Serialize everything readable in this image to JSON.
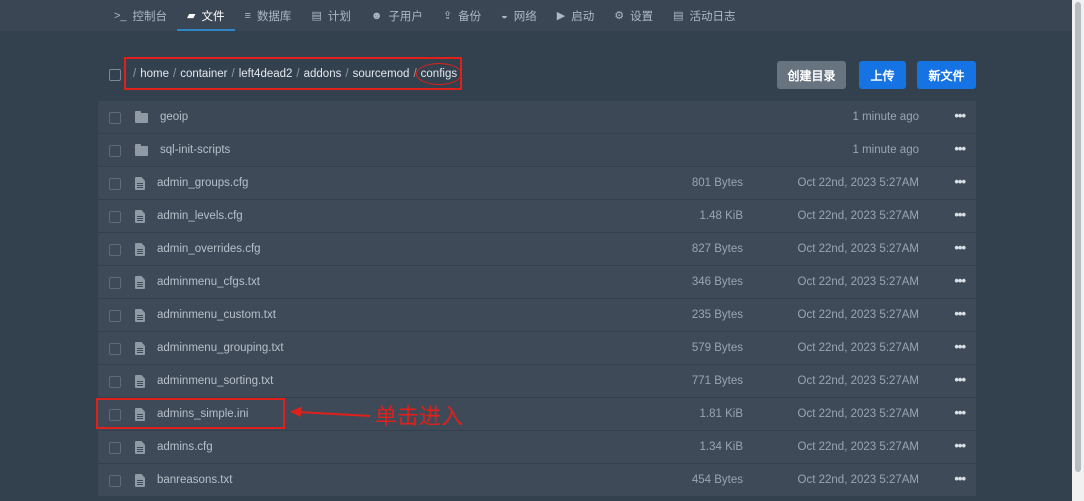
{
  "nav": [
    {
      "label": "控制台",
      "icon": "terminal-icon",
      "glyph": ">_",
      "active": false
    },
    {
      "label": "文件",
      "icon": "folder-icon",
      "glyph": "▰",
      "active": true
    },
    {
      "label": "数据库",
      "icon": "database-icon",
      "glyph": "≡",
      "active": false
    },
    {
      "label": "计划",
      "icon": "calendar-icon",
      "glyph": "▤",
      "active": false
    },
    {
      "label": "子用户",
      "icon": "users-icon",
      "glyph": "☻",
      "active": false
    },
    {
      "label": "备份",
      "icon": "upload-icon",
      "glyph": "⇪",
      "active": false
    },
    {
      "label": "网络",
      "icon": "network-icon",
      "glyph": "◒",
      "active": false
    },
    {
      "label": "启动",
      "icon": "play-icon",
      "glyph": "▶",
      "active": false
    },
    {
      "label": "设置",
      "icon": "gear-icon",
      "glyph": "⚙",
      "active": false
    },
    {
      "label": "活动日志",
      "icon": "log-icon",
      "glyph": "▤",
      "active": false
    }
  ],
  "breadcrumb": {
    "separator": "/",
    "parts": [
      "home",
      "container",
      "left4dead2",
      "addons",
      "sourcemod"
    ],
    "current": "configs"
  },
  "buttons": {
    "mkdir": "创建目录",
    "upload": "上传",
    "new_file": "新文件"
  },
  "more_glyph": "•••",
  "files": [
    {
      "type": "dir",
      "name": "geoip",
      "size": "",
      "date": "1 minute ago"
    },
    {
      "type": "dir",
      "name": "sql-init-scripts",
      "size": "",
      "date": "1 minute ago"
    },
    {
      "type": "file",
      "name": "admin_groups.cfg",
      "size": "801 Bytes",
      "date": "Oct 22nd, 2023 5:27AM"
    },
    {
      "type": "file",
      "name": "admin_levels.cfg",
      "size": "1.48 KiB",
      "date": "Oct 22nd, 2023 5:27AM"
    },
    {
      "type": "file",
      "name": "admin_overrides.cfg",
      "size": "827 Bytes",
      "date": "Oct 22nd, 2023 5:27AM"
    },
    {
      "type": "file",
      "name": "adminmenu_cfgs.txt",
      "size": "346 Bytes",
      "date": "Oct 22nd, 2023 5:27AM"
    },
    {
      "type": "file",
      "name": "adminmenu_custom.txt",
      "size": "235 Bytes",
      "date": "Oct 22nd, 2023 5:27AM"
    },
    {
      "type": "file",
      "name": "adminmenu_grouping.txt",
      "size": "579 Bytes",
      "date": "Oct 22nd, 2023 5:27AM"
    },
    {
      "type": "file",
      "name": "adminmenu_sorting.txt",
      "size": "771 Bytes",
      "date": "Oct 22nd, 2023 5:27AM"
    },
    {
      "type": "file",
      "name": "admins_simple.ini",
      "size": "1.81 KiB",
      "date": "Oct 22nd, 2023 5:27AM"
    },
    {
      "type": "file",
      "name": "admins.cfg",
      "size": "1.34 KiB",
      "date": "Oct 22nd, 2023 5:27AM"
    },
    {
      "type": "file",
      "name": "banreasons.txt",
      "size": "454 Bytes",
      "date": "Oct 22nd, 2023 5:27AM"
    }
  ],
  "annotation": {
    "text": "单击进入",
    "color": "#e0201b"
  }
}
